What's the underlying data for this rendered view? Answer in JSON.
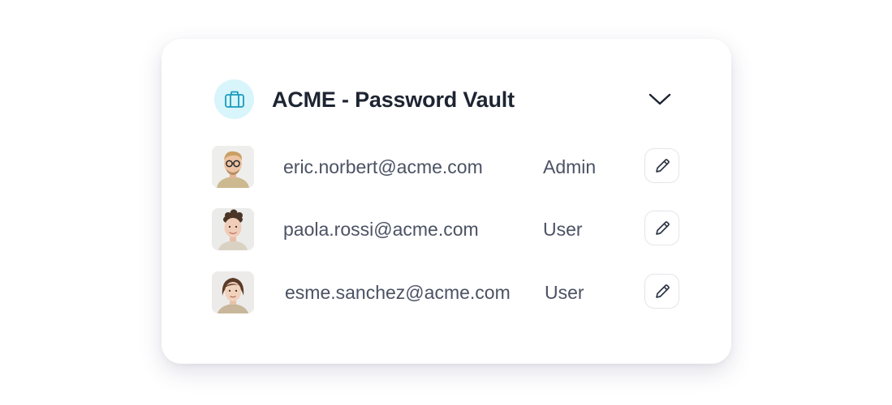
{
  "vault": {
    "title": "ACME - Password Vault",
    "icon": "briefcase-icon",
    "toggle_icon": "chevron-down-icon",
    "accent_bg": "#d7f5fb",
    "accent_stroke": "#1b9bbd"
  },
  "members": [
    {
      "email": "eric.norbert@acme.com",
      "role": "Admin",
      "edit_icon": "pencil-icon"
    },
    {
      "email": "paola.rossi@acme.com",
      "role": "User",
      "edit_icon": "pencil-icon"
    },
    {
      "email": "esme.sanchez@acme.com",
      "role": "User",
      "edit_icon": "pencil-icon"
    }
  ]
}
